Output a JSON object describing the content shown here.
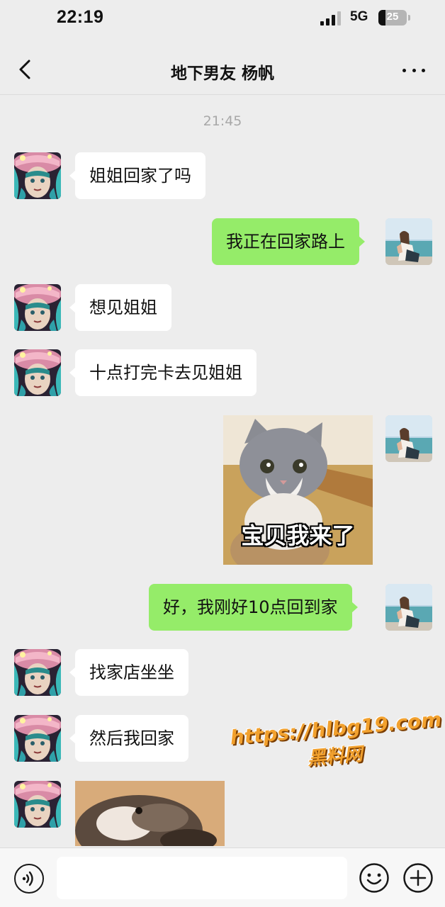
{
  "status_bar": {
    "time": "22:19",
    "network": "5G",
    "battery": "25",
    "battery_level": 0.25
  },
  "nav": {
    "title": "地下男友 杨帆",
    "back_icon": "chevron-left-icon",
    "more_icon": "more-dots-icon"
  },
  "chat": {
    "timestamp": "21:45",
    "messages": [
      {
        "side": "left",
        "type": "text",
        "text": "姐姐回家了吗"
      },
      {
        "side": "right",
        "type": "text",
        "text": "我正在回家路上"
      },
      {
        "side": "left",
        "type": "text",
        "text": "想见姐姐"
      },
      {
        "side": "left",
        "type": "text",
        "text": "十点打完卡去见姐姐"
      },
      {
        "side": "right",
        "type": "sticker",
        "caption": "宝贝我来了"
      },
      {
        "side": "right",
        "type": "text",
        "text": "好，我刚好10点回到家"
      },
      {
        "side": "left",
        "type": "text",
        "text": "找家店坐坐"
      },
      {
        "side": "left",
        "type": "text",
        "text": "然后我回家"
      },
      {
        "side": "left",
        "type": "image"
      }
    ]
  },
  "watermark": {
    "url": "https://hlbg19.com",
    "site": "黑料网"
  },
  "input_bar": {
    "placeholder": "",
    "voice_icon": "voice-icon",
    "emoji_icon": "emoji-icon",
    "plus_icon": "plus-icon"
  },
  "colors": {
    "background": "#ededed",
    "incoming_bubble": "#ffffff",
    "outgoing_bubble": "#95ec69",
    "watermark": "#f2a12e"
  }
}
